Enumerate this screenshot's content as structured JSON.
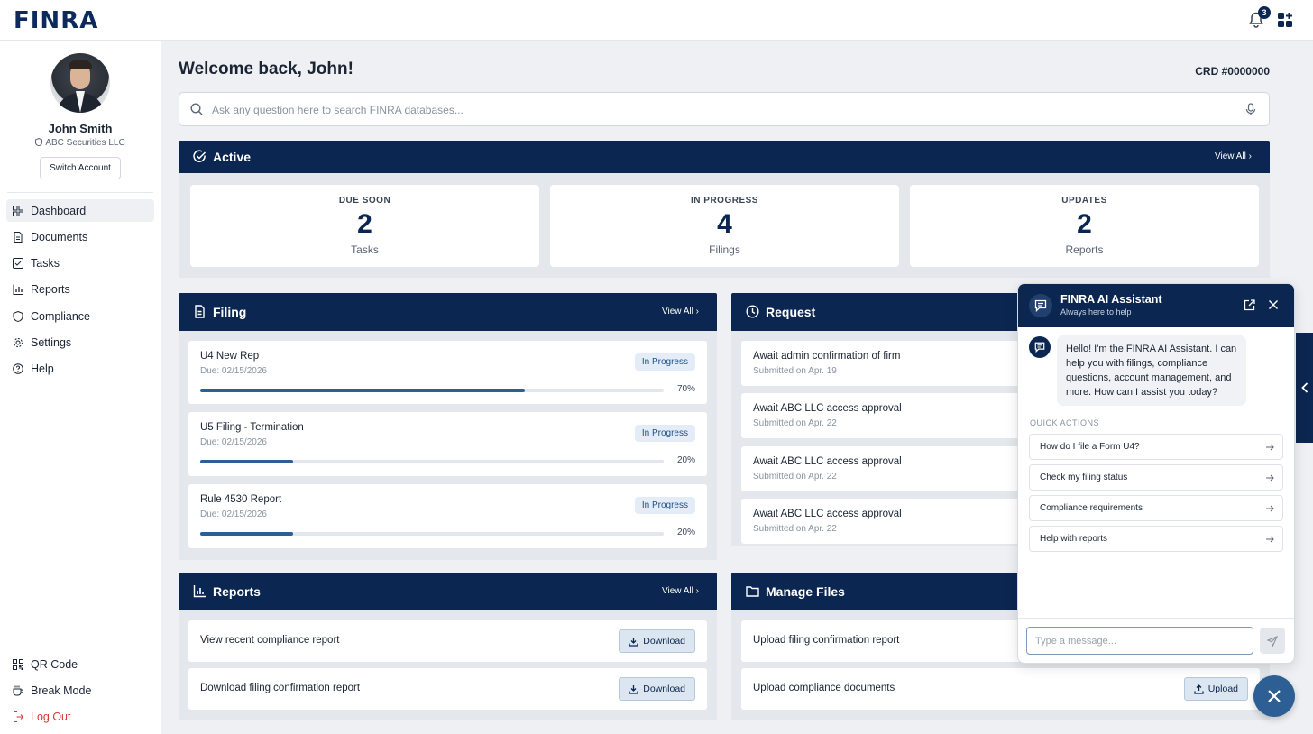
{
  "app": {
    "logo": "FINRA",
    "notifications_count": "3"
  },
  "user": {
    "name": "John Smith",
    "firm": "ABC Securities LLC",
    "switch_label": "Switch Account"
  },
  "nav": {
    "items": [
      {
        "label": "Dashboard",
        "icon": "dashboard-icon",
        "active": true
      },
      {
        "label": "Documents",
        "icon": "document-icon"
      },
      {
        "label": "Tasks",
        "icon": "task-check-icon"
      },
      {
        "label": "Reports",
        "icon": "bar-chart-icon"
      },
      {
        "label": "Compliance",
        "icon": "shield-icon"
      },
      {
        "label": "Settings",
        "icon": "gear-icon"
      },
      {
        "label": "Help",
        "icon": "help-circle-icon"
      }
    ],
    "bottom": [
      {
        "label": "QR Code",
        "icon": "qr-code-icon"
      },
      {
        "label": "Break Mode",
        "icon": "coffee-icon"
      },
      {
        "label": "Log Out",
        "icon": "logout-icon"
      }
    ]
  },
  "header": {
    "welcome": "Welcome back, John!",
    "crd": "CRD #0000000"
  },
  "search": {
    "placeholder": "Ask any question here to search FINRA databases..."
  },
  "active": {
    "title": "Active",
    "view_all": "View All",
    "stats": [
      {
        "label": "DUE SOON",
        "value": "2",
        "sub": "Tasks"
      },
      {
        "label": "IN PROGRESS",
        "value": "4",
        "sub": "Filings"
      },
      {
        "label": "UPDATES",
        "value": "2",
        "sub": "Reports"
      }
    ]
  },
  "filing": {
    "title": "Filing",
    "view_all": "View All",
    "items": [
      {
        "title": "U4 New Rep",
        "due": "Due: 02/15/2026",
        "status": "In Progress",
        "progress": 0.7,
        "pct": "70%"
      },
      {
        "title": "U5 Filing - Termination",
        "due": "Due: 02/15/2026",
        "status": "In Progress",
        "progress": 0.2,
        "pct": "20%"
      },
      {
        "title": "Rule 4530 Report",
        "due": "Due: 02/15/2026",
        "status": "In Progress",
        "progress": 0.2,
        "pct": "20%"
      }
    ]
  },
  "request": {
    "title": "Request",
    "items": [
      {
        "title": "Await admin confirmation of firm",
        "date": "Submitted on Apr. 19"
      },
      {
        "title": "Await ABC LLC access approval",
        "date": "Submitted on Apr. 22"
      },
      {
        "title": "Await ABC LLC access approval",
        "date": "Submitted on Apr. 22"
      },
      {
        "title": "Await ABC LLC access approval",
        "date": "Submitted on Apr. 22"
      }
    ]
  },
  "reports": {
    "title": "Reports",
    "view_all": "View All",
    "items": [
      {
        "title": "View recent compliance report",
        "button": "Download"
      },
      {
        "title": "Download filing confirmation report",
        "button": "Download"
      }
    ]
  },
  "files": {
    "title": "Manage Files",
    "items": [
      {
        "title": "Upload filing confirmation report"
      },
      {
        "title": "Upload compliance documents",
        "button": "Upload"
      }
    ]
  },
  "chat": {
    "title": "FINRA AI Assistant",
    "subtitle": "Always here to help",
    "greeting": "Hello! I'm the FINRA AI Assistant. I can help you with filings, compliance questions, account management, and more. How can I assist you today?",
    "quick_label": "QUICK ACTIONS",
    "quick_actions": [
      "How do I file a Form U4?",
      "Check my filing status",
      "Compliance requirements",
      "Help with reports"
    ],
    "input_placeholder": "Type a message..."
  },
  "colors": {
    "primary": "#0b2650",
    "accent": "#2d5f94",
    "danger": "#d23b3b",
    "background": "#eef0f3"
  }
}
